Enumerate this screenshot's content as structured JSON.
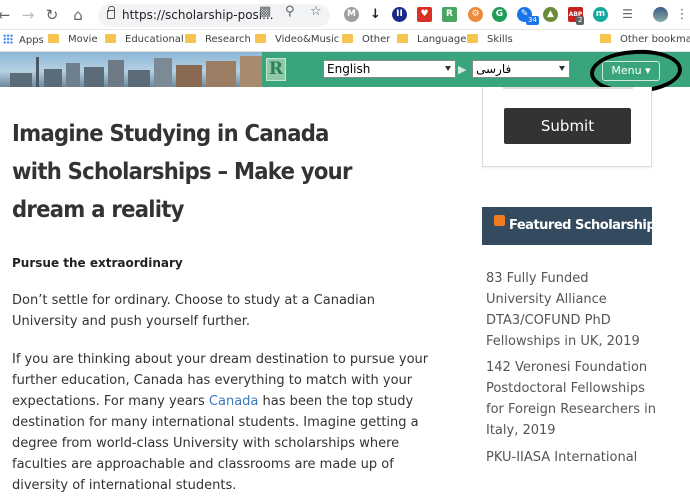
{
  "browser": {
    "url": "https://scholarship-posi...",
    "extensions": [
      "M",
      "↓",
      "II",
      "♥",
      "R",
      "⚙",
      "G",
      "✎",
      "▲",
      "ABP",
      "m",
      "☰"
    ],
    "extension_badges": {
      "blue": "34",
      "abp": "2"
    }
  },
  "bookmarks": [
    {
      "label": "Apps"
    },
    {
      "label": "Movie"
    },
    {
      "label": "Educational"
    },
    {
      "label": "Research"
    },
    {
      "label": "Video&Music"
    },
    {
      "label": "Other"
    },
    {
      "label": "Language"
    },
    {
      "label": "Skills"
    },
    {
      "label": "Other bookmarks"
    }
  ],
  "header": {
    "logo_letter": "R",
    "source_language": "English",
    "target_language": "فارسی",
    "menu_label": "Menu ▾"
  },
  "article": {
    "title": "Imagine Studying in Canada with Scholarships – Make your dream a reality",
    "subheading": "Pursue the extraordinary",
    "para1": "Don’t settle for ordinary. Choose to study at a Canadian University and push yourself further.",
    "para2_a": "If you are thinking about your dream destination to pursue your further education, Canada has everything to match with your expectations. For many years ",
    "para2_link": "Canada",
    "para2_b": " has been the top study destination for many international students. Imagine getting a degree from world-class University with scholarships where faculties are approachable and classrooms are made up of diversity of international students."
  },
  "sidebar": {
    "submit_label": "Submit",
    "featured_title": "Featured Scholarships",
    "links": [
      "83 Fully Funded University Alliance DTA3/COFUND PhD Fellowships in UK, 2019",
      "142 Veronesi Foundation Postdoctoral Fellowships for Foreign Researchers in Italy, 2019",
      "PKU-IIASA International"
    ]
  }
}
